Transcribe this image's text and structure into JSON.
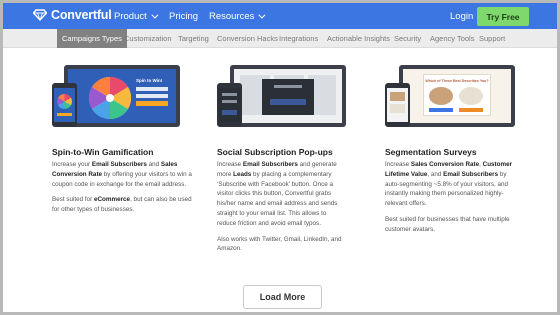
{
  "header": {
    "brand": "Convertful",
    "nav": [
      {
        "label": "Product",
        "has_dropdown": true
      },
      {
        "label": "Pricing",
        "has_dropdown": false
      },
      {
        "label": "Resources",
        "has_dropdown": true
      }
    ],
    "login_label": "Login",
    "cta_label": "Try Free",
    "colors": {
      "bar": "#3b76e3",
      "cta": "#7fd86c"
    }
  },
  "subnav": {
    "tabs": [
      "Campaigns Types",
      "Customization",
      "Targeting",
      "Conversion Hacks",
      "Integrations",
      "Actionable Insights",
      "Security",
      "Agency Tools",
      "Support"
    ],
    "active": "Campaigns Types"
  },
  "cards": [
    {
      "title": "Spin-to-Win Gamification",
      "text": [
        [
          "Increase your ",
          "Email Subscribers",
          " and ",
          "Sales Conversion Rate",
          " by offering your visitors to win a coupon code in exchange for the email address."
        ],
        [
          "Best suited for ",
          "eCommerce",
          ", but can also be used for other types of businesses."
        ]
      ],
      "mockup_text": "Spin to Win!"
    },
    {
      "title": "Social Subscription Pop-ups",
      "text": [
        [
          "Increase ",
          "Email Subscribers",
          " and generate more ",
          "Leads",
          " by placing a complementary ‘Subscribe with Facebook’ button. Once a visitor clicks this button, Convertful grabs his/her name and email address and sends straight to your email list. This allows to reduce friction and avoid email typos."
        ],
        [
          "Also works with Twitter, Gmail, LinkedIn, and Amazon."
        ]
      ]
    },
    {
      "title": "Segmentation Surveys",
      "text": [
        [
          "Increase ",
          "Sales Conversion Rate",
          ", ",
          "Customer Lifetime Value",
          ", and ",
          "Email Subscribers",
          " by auto-segmenting ~5.8% of your visitors, and instantly making them personalized highly-relevant offers."
        ],
        [
          "Best suited for businesses that have multiple customer avatars."
        ]
      ],
      "mockup_text": "Which of These Best Describes You?"
    }
  ],
  "load_more_label": "Load More"
}
